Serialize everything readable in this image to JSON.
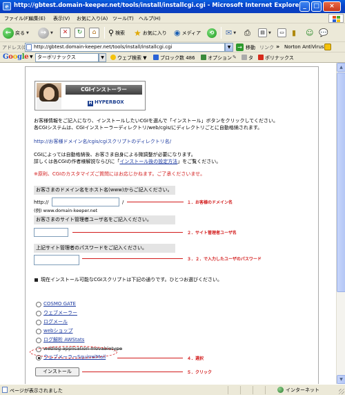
{
  "window": {
    "title": "http://gbtest.domain-keeper.net/tools/install/installcgi.cgi - Microsoft Internet Explorer",
    "minimize": "_",
    "maximize": "□",
    "close": "×"
  },
  "menu": [
    "ファイル(F)",
    "編集(E)",
    "表示(V)",
    "お気に入り(A)",
    "ツール(T)",
    "ヘルプ(H)"
  ],
  "toolbar": {
    "back": "戻る",
    "search": "検索",
    "favorites": "お気に入り",
    "media": "メディア"
  },
  "address": {
    "label": "アドレス(D)",
    "url": "http://gbtest.domain-keeper.net/tools/install/installcgi.cgi",
    "go": "移動",
    "links": "リンク",
    "chevron": "»",
    "norton": "Norton AntiVirus"
  },
  "google": {
    "logo": [
      "G",
      "o",
      "o",
      "g",
      "l",
      "e"
    ],
    "search_value": "ターボリナックス",
    "web_search": "ウェブ検索",
    "popup_block": "ブロック数 486",
    "options": "オプション",
    "item_ta": "タ",
    "turbolinux": "ポリナックス"
  },
  "page": {
    "logo": {
      "banner": "CGIインストーラー",
      "brand": "HYPERBOX",
      "brand_mark": "H"
    },
    "intro_line1": "お客様情報をご記入になり、インストールしたいCGIを選んで「インストール」ボタンをクリックしてください。",
    "intro_line2": "各CGIシステムは、CGIインストーラーディレクトリ/web/cgis/にディレクトリごとに自動格納されます。",
    "path_example": "http://お客様ドメイン名/cgis/cgiスクリプトのディレクトリ名/",
    "note_line1": "CGIによっては自動格納後、お客さま自身による微調整が必要になります。",
    "note_line2a": "詳しくは各CGIの作者様解説ならびに「",
    "note_link": "インストール後の設定方法",
    "note_line2b": "」をご覧ください。",
    "warning": "※原則、CGIのカスタマイズご質問にはお応じかねます。ご了承くださいませ。",
    "domain_section": "お客さまのドメイン名をホスト名(www)からご記入ください。",
    "http_prefix": "http://",
    "slash": "/",
    "domain_value": "",
    "domain_example": "(例) www.domain-keeper.net",
    "user_section": "お客さまのサイト管理者ユーザ名をご記入ください。",
    "user_value": "",
    "pass_section": "上記サイト管理者のパスワードをご記入ください。",
    "pass_value": "",
    "available_heading": "現在インストール可能なCGIスクリプトは下記の通りです。ひとつお選びください。",
    "scripts": [
      {
        "label": "COSMO GATE",
        "checked": false
      },
      {
        "label": "ウェブメーラー",
        "checked": false
      },
      {
        "label": "ログメール",
        "checked": false
      },
      {
        "label": "webショップ",
        "checked": false
      },
      {
        "label": "ログ解析 AWStats",
        "checked": false
      },
      {
        "label": "weblog application movabletype",
        "checked": false
      },
      {
        "label": "ウェブメーラーSquirrelMail",
        "checked": true
      }
    ],
    "install_button": "インストール"
  },
  "annotations": {
    "a1": "１．お客様のドメイン名",
    "a2": "２．サイト管理者ユーザ名",
    "a3": "３．２．で入力したユーザのパスワード",
    "a4": "４．選択",
    "a5": "５．クリック"
  },
  "status": {
    "text": "ページが表示されました",
    "zone": "インターネット"
  },
  "colors": {
    "titlebar": "#0a5fdf",
    "annotation": "#d21a1a",
    "link": "#1c3aa0",
    "chrome": "#ece9d8"
  }
}
